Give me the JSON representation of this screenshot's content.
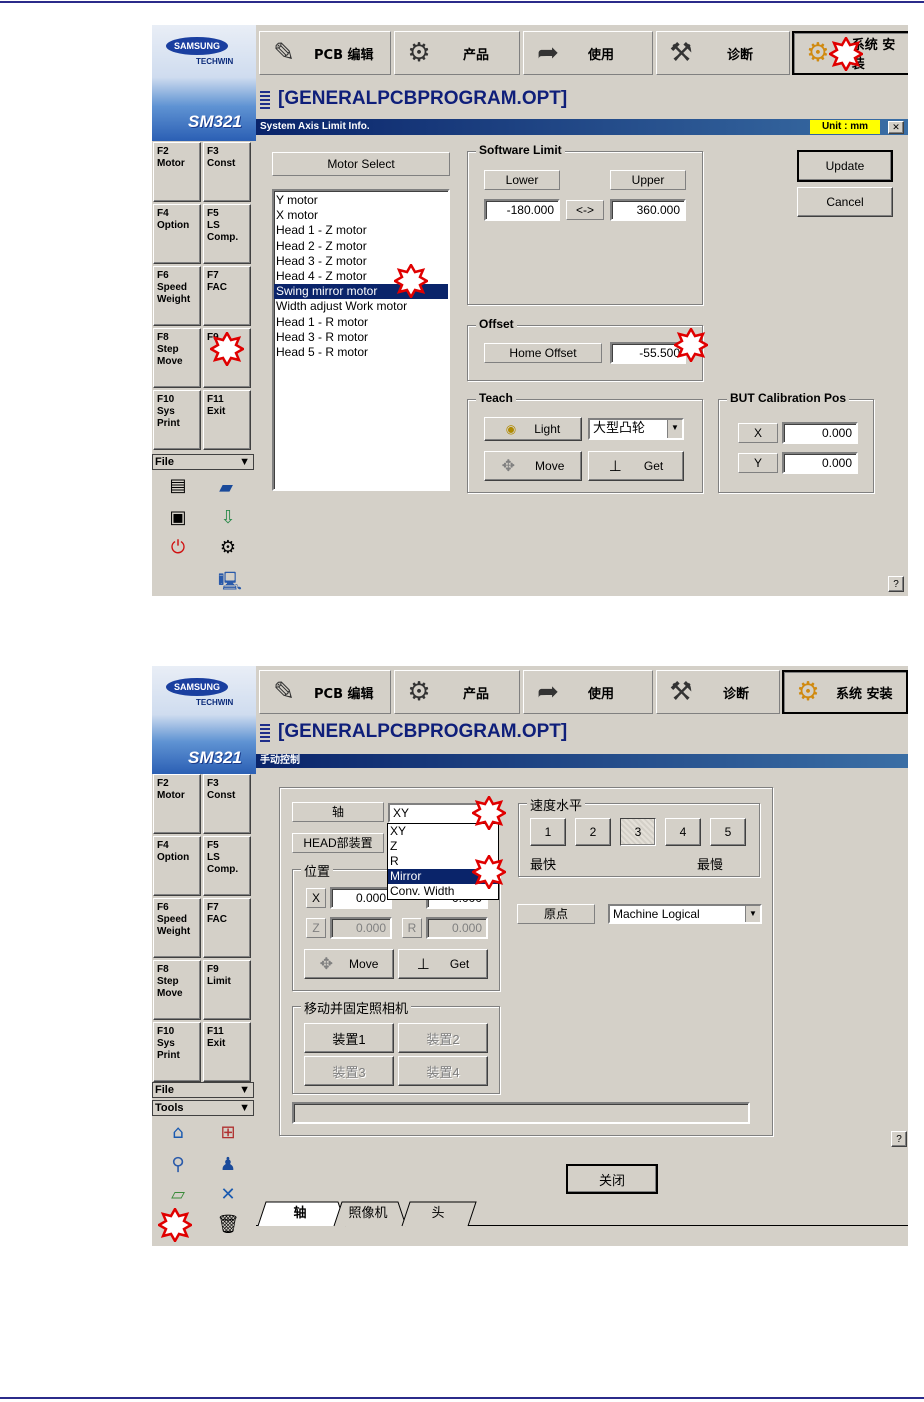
{
  "sidebar": {
    "brand": "SAMSUNG",
    "sub_brand": "TECHWIN",
    "model": "SM321",
    "fkeys_1": [
      {
        "label": "F2\nMotor"
      },
      {
        "label": "F3\nConst"
      },
      {
        "label": "F4\nOption"
      },
      {
        "label": "F5\nLS\nComp."
      },
      {
        "label": "F6\nSpeed\nWeight"
      },
      {
        "label": "F7\nFAC"
      },
      {
        "label": "F8\nStep\nMove"
      },
      {
        "label": "F9"
      },
      {
        "label": "F10\nSys\nPrint"
      },
      {
        "label": "F11\nExit"
      }
    ],
    "fkeys_2": [
      {
        "label": "F2\nMotor"
      },
      {
        "label": "F3\nConst"
      },
      {
        "label": "F4\nOption"
      },
      {
        "label": "F5\nLS\nComp."
      },
      {
        "label": "F6\nSpeed\nWeight"
      },
      {
        "label": "F7\nFAC"
      },
      {
        "label": "F8\nStep\nMove"
      },
      {
        "label": "F9\nLimit"
      },
      {
        "label": "F10\nSys\nPrint"
      },
      {
        "label": "F11\nExit"
      }
    ],
    "file_menu": "File",
    "tools_menu": "Tools",
    "file_icons_1": [
      "document-icon",
      "open-folder-icon",
      "save-icon",
      "import-icon",
      "power-icon",
      "settings-icon",
      "network-icon"
    ],
    "tools_icons_2": [
      "home-icon",
      "grid-icon",
      "tool-icon",
      "user-icon",
      "board-icon",
      "axis-icon",
      "deleted-icon",
      "trash-icon"
    ]
  },
  "toolbar": {
    "buttons": [
      {
        "label": "PCB 编辑",
        "icon": "pcb-edit-icon"
      },
      {
        "label": "产品",
        "icon": "product-gear-icon"
      },
      {
        "label": "使用",
        "icon": "use-arrow-icon"
      },
      {
        "label": "诊断",
        "icon": "diagnose-icon"
      },
      {
        "label": "系统 安装",
        "icon": "system-setup-icon"
      }
    ],
    "active": "系统 安装"
  },
  "program_title": "[GENERALPCBPROGRAM.OPT]",
  "dialog1": {
    "caption": "System Axis Limit Info.",
    "unit": "Unit : mm",
    "close": "✕",
    "motor_select": "Motor Select",
    "motors": [
      "Y motor",
      "X motor",
      "Head 1 - Z motor",
      "Head 2 - Z motor",
      "Head 3 - Z motor",
      "Head 4 - Z motor",
      "Swing mirror motor",
      "Width adjust Work motor",
      "Head 1 - R motor",
      "Head 3 - R motor",
      "Head 5 - R motor"
    ],
    "selected_motor": "Swing mirror motor",
    "software_limit": {
      "title": "Software Limit",
      "lower_label": "Lower",
      "upper_label": "Upper",
      "lower": "-180.000",
      "swap": "<->",
      "upper": "360.000"
    },
    "offset": {
      "title": "Offset",
      "label": "Home Offset",
      "value": "-55.500"
    },
    "teach": {
      "title": "Teach",
      "light": "Light",
      "combo": "大型凸轮",
      "move": "Move",
      "get": "Get"
    },
    "but_calib": {
      "title": "BUT Calibration Pos",
      "x_label": "X",
      "x": "0.000",
      "y_label": "Y",
      "y": "0.000"
    },
    "update": "Update",
    "cancel": "Cancel",
    "help": "?"
  },
  "dialog2": {
    "caption": "手动控制",
    "axis_label": "轴",
    "axis_value": "XY",
    "axis_options": [
      "XY",
      "Z",
      "R",
      "Mirror",
      "Conv. Width"
    ],
    "axis_highlight": "Mirror",
    "head_label": "HEAD部装置",
    "position": {
      "title": "位置",
      "x_label": "X",
      "x": "0.000",
      "y": "0.000",
      "z_label": "Z",
      "z": "0.000",
      "r_label": "R",
      "r": "0.000",
      "move": "Move",
      "get": "Get"
    },
    "speed": {
      "title": "速度水平",
      "levels": [
        "1",
        "2",
        "3",
        "4",
        "5"
      ],
      "selected": "3",
      "fastest": "最快",
      "slowest": "最慢"
    },
    "origin_label": "原点",
    "origin_value": "Machine Logical",
    "camera": {
      "title": "移动并固定照相机",
      "buttons": [
        "装置1",
        "装置2",
        "装置3",
        "装置4"
      ]
    },
    "close": "关闭",
    "help": "?",
    "tabs": [
      "轴",
      "照像机",
      "头"
    ]
  },
  "colors": {
    "caption": "#0a246a",
    "face": "#d4d0c8",
    "title_text": "#0f1f7a",
    "marker": "#e00000"
  }
}
